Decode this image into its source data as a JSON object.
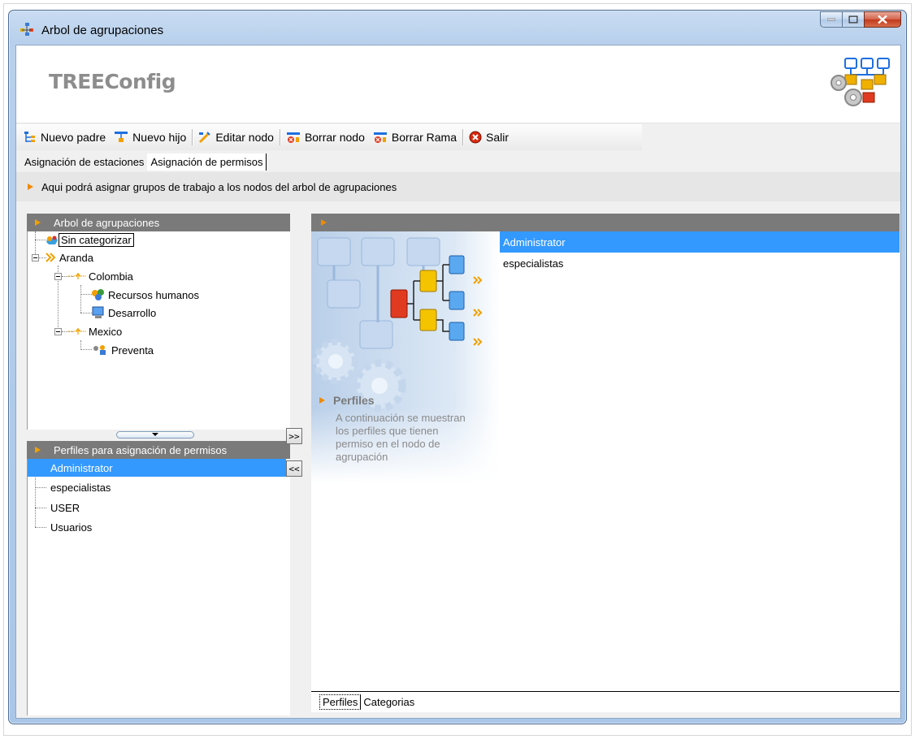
{
  "window": {
    "title": "Arbol de agrupaciones"
  },
  "header": {
    "app_title": "TREEConfig"
  },
  "toolbar": {
    "new_parent": "Nuevo padre",
    "new_child": "Nuevo hijo",
    "edit_node": "Editar nodo",
    "delete_node": "Borrar nodo",
    "delete_branch": "Borrar Rama",
    "exit": "Salir"
  },
  "tabs": {
    "stations": "Asignación de estaciones",
    "permissions": "Asignación de permisos"
  },
  "info": {
    "text": "Aqui podrá asignar grupos de trabajo a los nodos del arbol de agrupaciones"
  },
  "tree_panel": {
    "title": "Arbol de agrupaciones",
    "nodes": {
      "uncategorized": "Sin categorizar",
      "aranda": "Aranda",
      "colombia": "Colombia",
      "rrhh": "Recursos humanos",
      "desarrollo": "Desarrollo",
      "mexico": "Mexico",
      "preventa": "Preventa"
    }
  },
  "profiles_panel": {
    "title": "Perfiles para asignación de permisos",
    "items": [
      "Administrator",
      "especialistas",
      "USER",
      "Usuarios"
    ],
    "selected": "Administrator"
  },
  "transfer": {
    "add": ">>",
    "remove": "<<"
  },
  "assigned_panel": {
    "art_title": "Perfiles",
    "art_description": "A continuación se muestran los perfiles que tienen permiso en el nodo de agrupación",
    "items": [
      "Administrator",
      "especialistas"
    ],
    "selected": "Administrator"
  },
  "bottom_tabs": {
    "profiles": "Perfiles",
    "categories": "Categorias"
  },
  "colors": {
    "selection": "#3399ff",
    "panel_header": "#7a7a7a",
    "accent_arrow": "#f08a00"
  }
}
